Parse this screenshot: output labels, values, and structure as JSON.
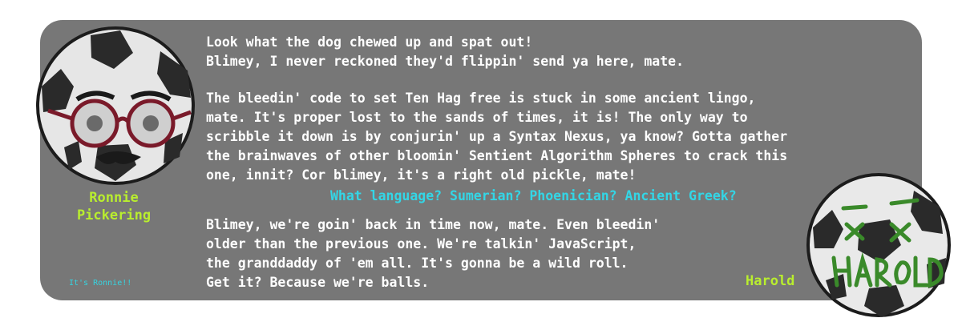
{
  "speaker": {
    "name": "Ronnie\nPickering",
    "caption": "It's Ronnie!!"
  },
  "partner": {
    "name": "Harold",
    "ball_scribble": "HAROLD"
  },
  "dialog": {
    "lines": [
      "Look what the dog chewed up and spat out!\nBlimey, I never reckoned they'd flippin' send ya here, mate.",
      "The bleedin' code to set Ten Hag free is stuck in some ancient lingo,\nmate. It's proper lost to the sands of times, it is! The only way to\nscribble it down is by conjurin' up a Syntax Nexus, ya know? Gotta gather\nthe brainwaves of other bloomin' Sentient Algorithm Spheres to crack this\none, innit? Cor blimey, it's a right old pickle, mate!",
      "Blimey, we're goin' back in time now, mate. Even bleedin'\nolder than the previous one. We're talkin' JavaScript,\nthe granddaddy of 'em all. It's gonna be a wild roll.\nGet it? Because we're balls."
    ],
    "choice": "What language? Sumerian? Phoenician? Ancient Greek?"
  },
  "colors": {
    "panel": "#777777",
    "name": "#b9ee2e",
    "choice": "#33d6e6",
    "text": "#ffffff"
  }
}
